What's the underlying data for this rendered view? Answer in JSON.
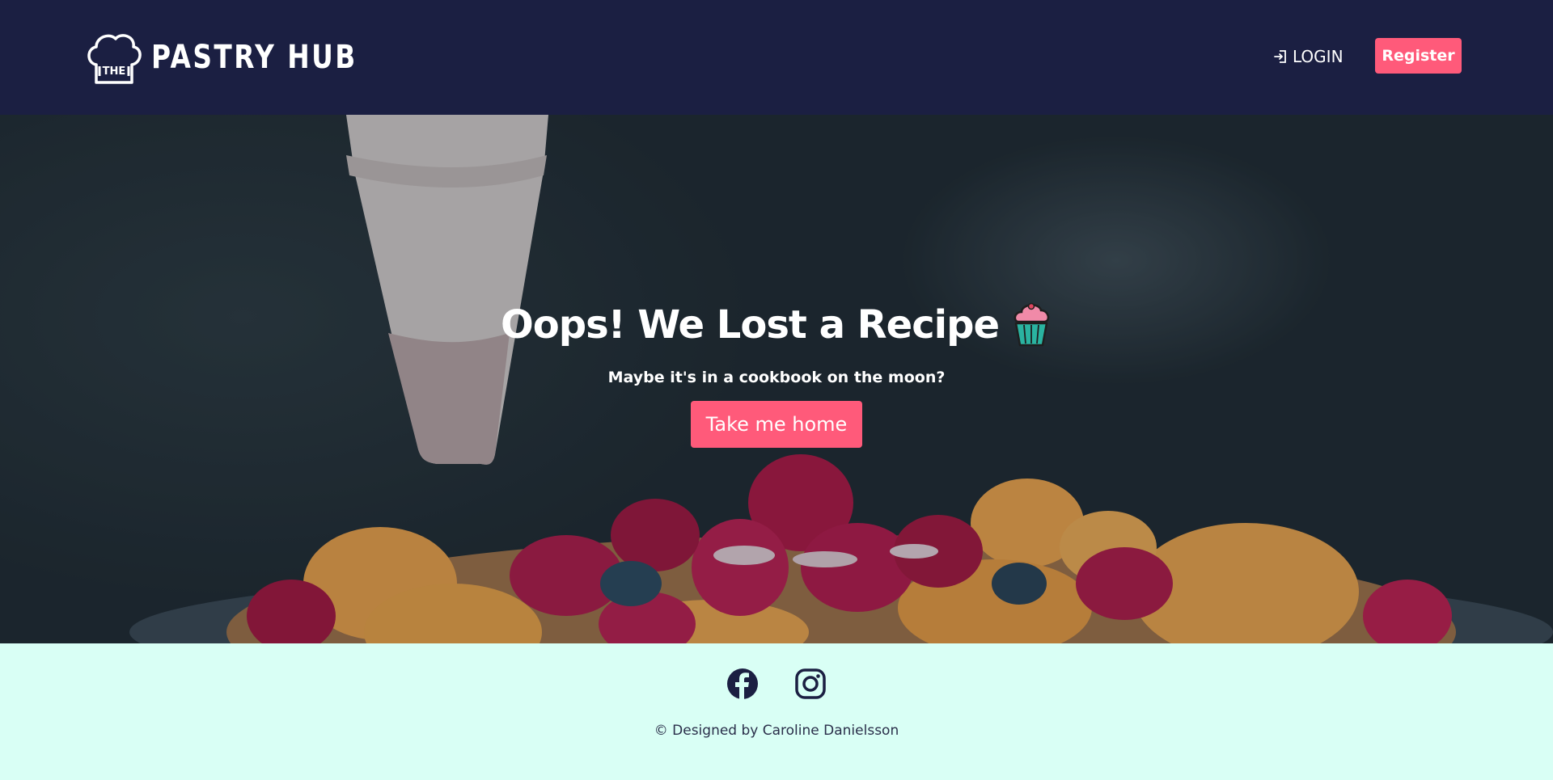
{
  "header": {
    "brand_small": "THE",
    "brand_name": "PASTRY HUB",
    "login_label": "LOGIN",
    "register_label": "Register"
  },
  "hero": {
    "title": "Oops! We Lost a Recipe",
    "title_emoji": "🧁",
    "subtitle": "Maybe it's in a cookbook on the moon?",
    "button_label": "Take me home"
  },
  "footer": {
    "social": [
      {
        "name": "facebook-icon"
      },
      {
        "name": "instagram-icon"
      }
    ],
    "copyright": "© Designed by Caroline Danielsson"
  },
  "colors": {
    "nav_bg": "#1b1f42",
    "accent": "#ff5a7a",
    "footer_bg": "#d9fff5",
    "footer_text": "#2a2f4a"
  }
}
